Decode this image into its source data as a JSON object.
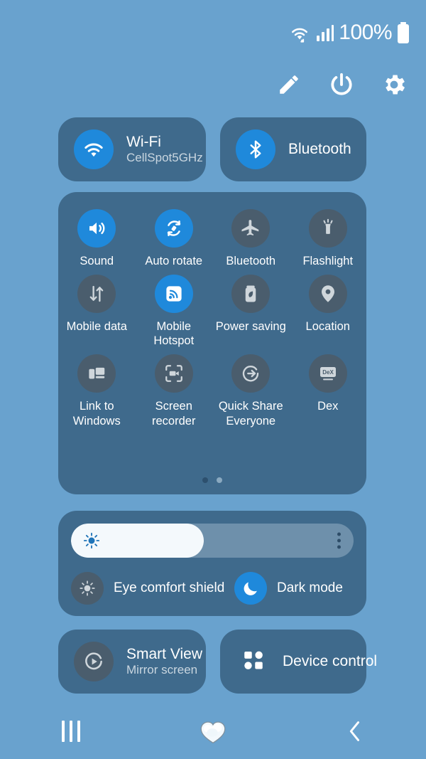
{
  "status_bar": {
    "battery_percent": "100%",
    "icons": [
      "wifi-data-icon",
      "signal-bars-icon",
      "battery-icon"
    ]
  },
  "header": {
    "buttons": [
      {
        "name": "edit-pencil-icon",
        "label": "Edit"
      },
      {
        "name": "power-icon",
        "label": "Power"
      },
      {
        "name": "settings-gear-icon",
        "label": "Settings"
      }
    ]
  },
  "top_tiles": [
    {
      "title": "Wi-Fi",
      "subtitle": "CellSpot5GHz",
      "icon": "wifi-icon",
      "active": true
    },
    {
      "title": "Bluetooth",
      "subtitle": "",
      "icon": "bluetooth-icon",
      "active": true
    }
  ],
  "quick_settings": {
    "tiles": [
      {
        "label": "Sound",
        "icon": "sound-icon",
        "active": true
      },
      {
        "label": "Auto rotate",
        "icon": "auto-rotate-icon",
        "active": true
      },
      {
        "label": "Bluetooth",
        "icon": "airplane-icon",
        "active": false
      },
      {
        "label": "Flashlight",
        "icon": "flashlight-icon",
        "active": false
      },
      {
        "label": "Mobile data",
        "icon": "mobile-data-icon",
        "active": false
      },
      {
        "label": "Mobile Hotspot",
        "icon": "hotspot-icon",
        "active": true
      },
      {
        "label": "Power saving",
        "icon": "power-saving-icon",
        "active": false
      },
      {
        "label": "Location",
        "icon": "location-pin-icon",
        "active": false
      },
      {
        "label": "Link to Windows",
        "icon": "link-to-windows-icon",
        "active": false
      },
      {
        "label": "Screen recorder",
        "icon": "screen-recorder-icon",
        "active": false
      },
      {
        "label": "Quick Share Everyone",
        "icon": "quick-share-icon",
        "active": false
      },
      {
        "label": "Dex",
        "icon": "dex-icon",
        "active": false,
        "glyph_text": "DeX"
      }
    ],
    "page_dots": {
      "count": 2,
      "active_index": 0
    }
  },
  "brightness": {
    "value_percent": 47,
    "slider_icon": "brightness-sun-icon",
    "menu_icon": "more-options-icon",
    "modes": [
      {
        "label": "Eye comfort shield",
        "icon": "eye-comfort-icon",
        "active": false
      },
      {
        "label": "Dark mode",
        "icon": "moon-icon",
        "active": true
      }
    ]
  },
  "bottom_tiles": [
    {
      "title": "Smart View",
      "subtitle": "Mirror screen",
      "icon": "smart-view-icon",
      "active": false
    },
    {
      "title": "Device control",
      "subtitle": "",
      "icon": "device-control-icon",
      "active": false
    }
  ],
  "nav_bar": {
    "buttons": [
      {
        "name": "recents-icon",
        "label": "Recents"
      },
      {
        "name": "home-cloud-heart-icon",
        "label": "Home"
      },
      {
        "name": "back-icon",
        "label": "Back"
      }
    ]
  },
  "colors": {
    "background": "#69a2ce",
    "panel": "#3f6a8c",
    "active_blue": "#1f89db",
    "inactive_gray": "#4a5d6d",
    "text_primary": "#ffffff",
    "text_secondary": "#c9d6e0"
  }
}
